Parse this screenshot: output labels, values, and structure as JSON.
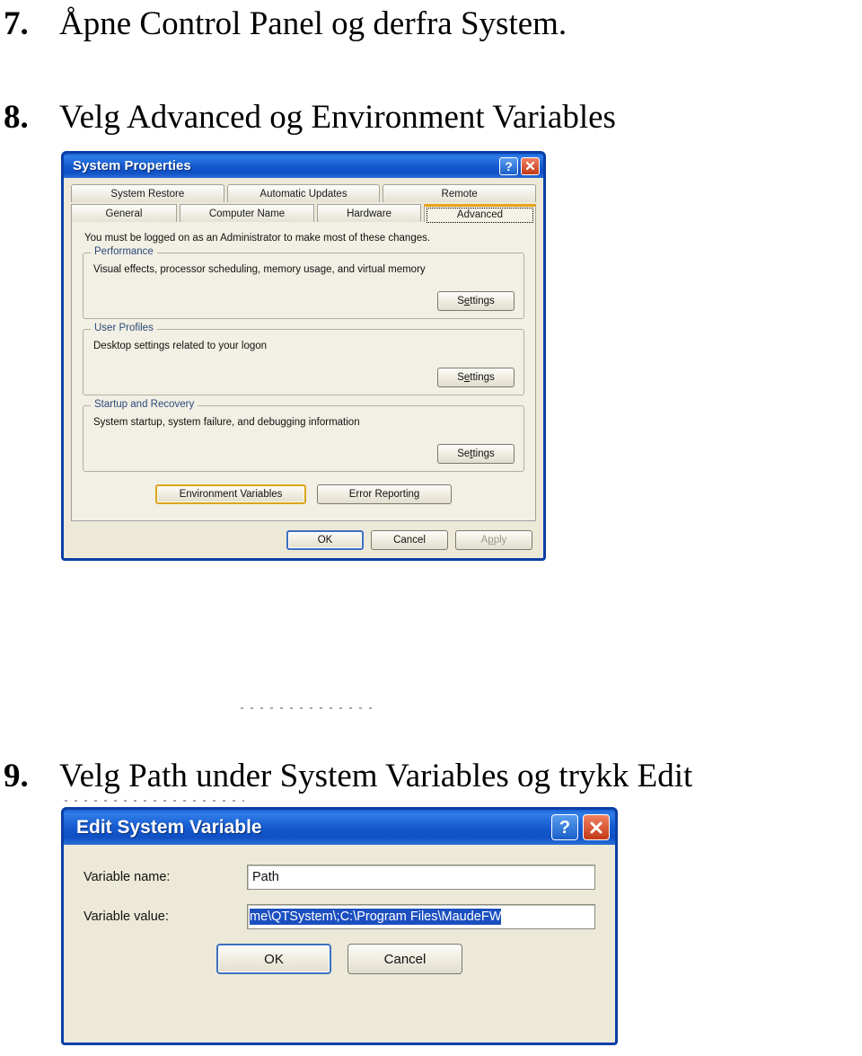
{
  "document": {
    "steps": [
      {
        "number": "7.",
        "text": "Åpne Control Panel og derfra System."
      },
      {
        "number": "8.",
        "text": "Velg Advanced og Environment Variables"
      },
      {
        "number": "9.",
        "text": "Velg Path under System Variables og trykk Edit"
      }
    ]
  },
  "system_properties": {
    "title": "System Properties",
    "titlebar_buttons": {
      "help": "?",
      "close": "close-icon"
    },
    "tabs_row1": [
      {
        "label": "System Restore",
        "active": false
      },
      {
        "label": "Automatic Updates",
        "active": false
      },
      {
        "label": "Remote",
        "active": false
      }
    ],
    "tabs_row2": [
      {
        "label": "General",
        "active": false
      },
      {
        "label": "Computer Name",
        "active": false
      },
      {
        "label": "Hardware",
        "active": false
      },
      {
        "label": "Advanced",
        "active": true
      }
    ],
    "notice": "You must be logged on as an Administrator to make most of these changes.",
    "groups": [
      {
        "legend": "Performance",
        "description": "Visual effects, processor scheduling, memory usage, and virtual memory",
        "button": "Settings",
        "button_accel": "e"
      },
      {
        "legend": "User Profiles",
        "description": "Desktop settings related to your logon",
        "button": "Settings",
        "button_accel": "e"
      },
      {
        "legend": "Startup and Recovery",
        "description": "System startup, system failure, and debugging information",
        "button": "Settings",
        "button_accel": "e"
      }
    ],
    "extra_buttons": [
      {
        "label": "Environment Variables",
        "style": "highlight"
      },
      {
        "label": "Error Reporting",
        "style": "normal"
      }
    ],
    "footer_buttons": [
      {
        "label": "OK",
        "style": "default"
      },
      {
        "label": "Cancel",
        "style": "normal"
      },
      {
        "label": "Apply",
        "style": "disabled"
      }
    ]
  },
  "edit_system_variable": {
    "title": "Edit System Variable",
    "titlebar_buttons": {
      "help": "?",
      "close": "close-icon"
    },
    "fields": [
      {
        "label": "Variable name:",
        "value": "Path",
        "selected": false
      },
      {
        "label": "Variable value:",
        "value": "me\\QTSystem\\;C:\\Program Files\\MaudeFW",
        "selected": true
      }
    ],
    "buttons": [
      {
        "label": "OK",
        "style": "default"
      },
      {
        "label": "Cancel",
        "style": "normal"
      }
    ]
  },
  "colors": {
    "titlebar_blue": "#1559cf",
    "dialog_face": "#ece9d8",
    "selection_blue": "#1b4fc0",
    "active_tab_accent": "#e8a317",
    "highlight_button": "#d9a520",
    "group_legend": "#2b4a7a"
  }
}
